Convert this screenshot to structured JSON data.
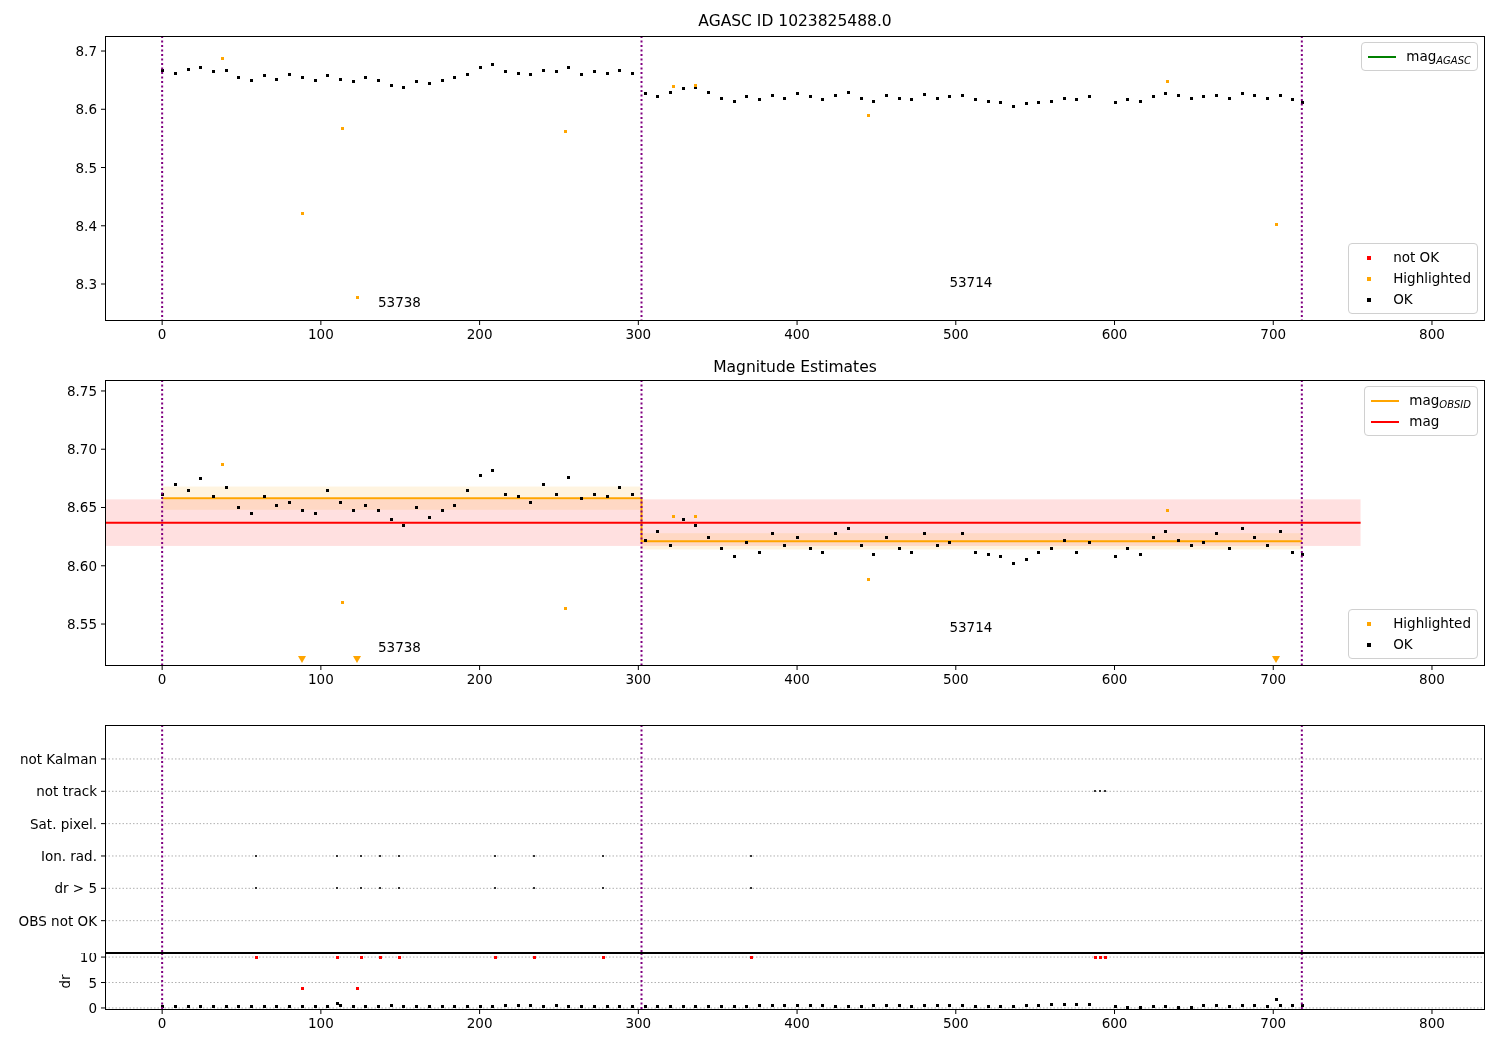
{
  "figure": {
    "panels": [
      {
        "chart_data": {
          "type": "scatter",
          "title": "AGASC ID 1023825488.0",
          "xlim": [
            -36,
            833.4
          ],
          "ylim": [
            8.2365,
            8.7258
          ],
          "xticks": [
            0,
            100,
            200,
            300,
            400,
            500,
            600,
            700,
            800
          ],
          "yticks": [
            8.3,
            8.4,
            8.5,
            8.6,
            8.7
          ],
          "legend": true,
          "series": [
            {
              "name": "OK",
              "color": "#000000",
              "type": "scatter",
              "x": [
                0,
                8,
                16,
                24,
                32,
                40,
                48,
                56,
                64,
                72,
                80,
                88,
                96,
                104,
                112,
                120,
                128,
                136,
                144,
                152,
                160,
                168,
                176,
                184,
                192,
                200,
                208,
                216,
                224,
                232,
                240,
                248,
                256,
                264,
                272,
                280,
                288,
                296,
                304,
                312,
                320,
                328,
                336,
                344,
                352,
                360,
                368,
                376,
                384,
                392,
                400,
                408,
                416,
                424,
                432,
                440,
                448,
                456,
                464,
                472,
                480,
                488,
                496,
                504,
                512,
                520,
                528,
                536,
                544,
                552,
                560,
                568,
                576,
                584,
                600,
                608,
                616,
                624,
                632,
                640,
                648,
                656,
                664,
                672,
                680,
                688,
                696,
                704,
                712,
                718
              ],
              "values": [
                8.668,
                8.662,
                8.67,
                8.672,
                8.665,
                8.668,
                8.655,
                8.65,
                8.658,
                8.652,
                8.66,
                8.655,
                8.65,
                8.658,
                8.652,
                8.648,
                8.655,
                8.65,
                8.642,
                8.638,
                8.648,
                8.645,
                8.65,
                8.655,
                8.66,
                8.672,
                8.678,
                8.665,
                8.662,
                8.66,
                8.668,
                8.665,
                8.672,
                8.66,
                8.665,
                8.662,
                8.668,
                8.662,
                8.628,
                8.622,
                8.63,
                8.636,
                8.638,
                8.63,
                8.62,
                8.615,
                8.622,
                8.618,
                8.625,
                8.62,
                8.628,
                8.622,
                8.618,
                8.625,
                8.63,
                8.62,
                8.615,
                8.625,
                8.62,
                8.618,
                8.626,
                8.62,
                8.622,
                8.625,
                8.618,
                8.615,
                8.612,
                8.605,
                8.61,
                8.612,
                8.615,
                8.62,
                8.618,
                8.622,
                8.612,
                8.618,
                8.615,
                8.622,
                8.628,
                8.625,
                8.62,
                8.622,
                8.625,
                8.62,
                8.628,
                8.625,
                8.62,
                8.625,
                8.618,
                8.612
              ]
            },
            {
              "name": "Highlighted",
              "color": "#ffa500",
              "type": "scatter",
              "x": [
                38,
                88,
                113,
                123,
                254,
                322,
                336,
                445,
                633,
                702
              ],
              "values": [
                8.688,
                8.422,
                8.568,
                8.278,
                8.563,
                8.64,
                8.642,
                8.59,
                8.648,
                8.403
              ]
            }
          ],
          "ref_lines": [
            {
              "axis": "x",
              "value": 0,
              "color": "#800080"
            },
            {
              "axis": "x",
              "value": 302,
              "color": "#800080"
            },
            {
              "axis": "x",
              "value": 718,
              "color": "#800080"
            }
          ],
          "annotations": [
            "53738",
            "53714"
          ]
        },
        "legend_extras": [
          {
            "label": "mag$_{AGASC}$",
            "kind": "line",
            "color": "#008000"
          },
          {
            "label": "not OK",
            "kind": "dot",
            "color": "#ff0000"
          }
        ]
      },
      {
        "chart_data": {
          "type": "scatter",
          "title": "Magnitude Estimates",
          "xlim": [
            -36,
            833.4
          ],
          "ylim": [
            8.514,
            8.7594
          ],
          "xticks": [
            0,
            100,
            200,
            300,
            400,
            500,
            600,
            700,
            800
          ],
          "yticks": [
            {
              "value": 8.55,
              "label": "8.55"
            },
            {
              "value": 8.6,
              "label": "8.60"
            },
            {
              "value": 8.65,
              "label": "8.65"
            },
            {
              "value": 8.7,
              "label": "8.70"
            },
            {
              "value": 8.75,
              "label": "8.75"
            }
          ],
          "legend": true,
          "series": [
            {
              "name": "mag$_{OBSID}$",
              "color": "#ffa500",
              "type": "line",
              "x": [
                0,
                302,
                302,
                718
              ],
              "values": [
                8.658,
                8.658,
                8.621,
                8.621
              ]
            },
            {
              "name": "mag",
              "color": "#ff0000",
              "type": "line",
              "x": [
                -36,
                755
              ],
              "values": [
                8.637,
                8.637
              ]
            },
            {
              "name": "OK",
              "color": "#000000",
              "type": "scatter",
              "x": [
                0,
                8,
                16,
                24,
                32,
                40,
                48,
                56,
                64,
                72,
                80,
                88,
                96,
                104,
                112,
                120,
                128,
                136,
                144,
                152,
                160,
                168,
                176,
                184,
                192,
                200,
                208,
                216,
                224,
                232,
                240,
                248,
                256,
                264,
                272,
                280,
                288,
                296,
                304,
                312,
                320,
                328,
                336,
                344,
                352,
                360,
                368,
                376,
                384,
                392,
                400,
                408,
                416,
                424,
                432,
                440,
                448,
                456,
                464,
                472,
                480,
                488,
                496,
                504,
                512,
                520,
                528,
                536,
                544,
                552,
                560,
                568,
                576,
                584,
                600,
                608,
                616,
                624,
                632,
                640,
                648,
                656,
                664,
                672,
                680,
                688,
                696,
                704,
                712,
                718
              ],
              "values": [
                8.662,
                8.67,
                8.665,
                8.675,
                8.66,
                8.668,
                8.65,
                8.645,
                8.66,
                8.652,
                8.655,
                8.648,
                8.645,
                8.665,
                8.655,
                8.648,
                8.652,
                8.648,
                8.64,
                8.635,
                8.65,
                8.642,
                8.648,
                8.652,
                8.665,
                8.678,
                8.682,
                8.662,
                8.66,
                8.655,
                8.67,
                8.662,
                8.676,
                8.658,
                8.662,
                8.66,
                8.668,
                8.662,
                8.622,
                8.63,
                8.618,
                8.64,
                8.635,
                8.625,
                8.615,
                8.608,
                8.62,
                8.612,
                8.628,
                8.618,
                8.625,
                8.615,
                8.612,
                8.628,
                8.632,
                8.618,
                8.61,
                8.625,
                8.615,
                8.612,
                8.628,
                8.618,
                8.62,
                8.628,
                8.612,
                8.61,
                8.608,
                8.602,
                8.606,
                8.612,
                8.615,
                8.622,
                8.612,
                8.62,
                8.608,
                8.615,
                8.61,
                8.625,
                8.63,
                8.622,
                8.618,
                8.62,
                8.628,
                8.615,
                8.632,
                8.625,
                8.618,
                8.63,
                8.612,
                8.61
              ]
            },
            {
              "name": "Highlighted",
              "color": "#ffa500",
              "type": "scatter",
              "x": [
                38,
                113,
                254,
                322,
                336,
                445,
                633
              ],
              "values": [
                8.687,
                8.569,
                8.564,
                8.643,
                8.643,
                8.589,
                8.648
              ]
            },
            {
              "color": "#ffa500",
              "type": "scatter",
              "marker": "triangle-down",
              "x": [
                88,
                123,
                702
              ],
              "values": [
                8.52,
                8.52,
                8.52
              ]
            }
          ],
          "bands": [
            {
              "axis": "y",
              "from": 8.617,
              "to": 8.657,
              "color": "#ff0000"
            },
            {
              "axis": "y",
              "from": 8.648,
              "to": 8.668,
              "color": "#ffa500"
            },
            {
              "axis": "y",
              "from": 8.614,
              "to": 8.628,
              "color": "#ffa500"
            }
          ],
          "ref_lines": [
            {
              "axis": "x",
              "value": 0,
              "color": "#800080"
            },
            {
              "axis": "x",
              "value": 302,
              "color": "#800080"
            },
            {
              "axis": "x",
              "value": 718,
              "color": "#800080"
            }
          ],
          "annotations": [
            "53738",
            "53714"
          ]
        }
      },
      {
        "chart_data": {
          "type": "scatter",
          "orientation": "horizontal",
          "xlim": [
            -36,
            833.4
          ],
          "grid": true,
          "categories": [
            "not Kalman",
            "not track",
            "Sat. pixel.",
            "Ion. rad.",
            "dr > 5",
            "OBS not OK"
          ],
          "series": [
            {
              "color": "#333333",
              "values": [
                null,
                null,
                null,
                59,
                59,
                null
              ]
            },
            {
              "color": "#333333",
              "values": [
                null,
                null,
                null,
                110,
                110,
                null
              ]
            },
            {
              "color": "#333333",
              "values": [
                null,
                null,
                null,
                125,
                125,
                null
              ]
            },
            {
              "color": "#333333",
              "values": [
                null,
                null,
                null,
                137,
                137,
                null
              ]
            },
            {
              "color": "#333333",
              "values": [
                null,
                null,
                null,
                149,
                149,
                null
              ]
            },
            {
              "color": "#333333",
              "values": [
                null,
                null,
                null,
                210,
                210,
                null
              ]
            },
            {
              "color": "#333333",
              "values": [
                null,
                null,
                null,
                234,
                234,
                null
              ]
            },
            {
              "color": "#333333",
              "values": [
                null,
                null,
                null,
                278,
                278,
                null
              ]
            },
            {
              "color": "#333333",
              "values": [
                null,
                null,
                null,
                371,
                371,
                null
              ]
            },
            {
              "color": "#333333",
              "values": [
                null,
                588,
                null,
                null,
                null,
                null
              ]
            },
            {
              "color": "#333333",
              "values": [
                null,
                591,
                null,
                null,
                null,
                null
              ]
            },
            {
              "color": "#333333",
              "values": [
                null,
                594,
                null,
                null,
                null,
                null
              ]
            }
          ],
          "ref_lines": [
            {
              "axis": "x",
              "value": 0,
              "color": "#800080"
            },
            {
              "axis": "x",
              "value": 302,
              "color": "#800080"
            },
            {
              "axis": "x",
              "value": 718,
              "color": "#800080"
            }
          ]
        }
      },
      {
        "chart_data": {
          "type": "scatter",
          "ylabel": "dr",
          "xlim": [
            -36,
            833.4
          ],
          "ylim": [
            -0.4,
            10.8
          ],
          "grid": true,
          "xticks": [
            0,
            100,
            200,
            300,
            400,
            500,
            600,
            700,
            800
          ],
          "yticks": [
            0,
            5,
            10
          ],
          "series": [
            {
              "color": "#000000",
              "type": "scatter",
              "x": [
                0,
                8,
                16,
                24,
                32,
                40,
                48,
                56,
                64,
                72,
                80,
                88,
                96,
                104,
                112,
                120,
                128,
                136,
                144,
                152,
                160,
                168,
                176,
                184,
                192,
                200,
                208,
                216,
                224,
                232,
                240,
                248,
                256,
                264,
                272,
                280,
                288,
                296,
                304,
                312,
                320,
                328,
                336,
                344,
                352,
                360,
                368,
                376,
                384,
                392,
                400,
                408,
                416,
                424,
                432,
                440,
                448,
                456,
                464,
                472,
                480,
                488,
                496,
                504,
                512,
                520,
                528,
                536,
                544,
                552,
                560,
                568,
                576,
                584,
                600,
                608,
                616,
                624,
                632,
                640,
                648,
                656,
                664,
                672,
                680,
                688,
                696,
                704,
                712,
                718,
                110,
                702
              ],
              "values": [
                0.3,
                0.3,
                0.3,
                0.3,
                0.3,
                0.3,
                0.4,
                0.3,
                0.3,
                0.3,
                0.3,
                0.3,
                0.3,
                0.3,
                0.5,
                0.4,
                0.3,
                0.3,
                0.5,
                0.4,
                0.3,
                0.3,
                0.3,
                0.3,
                0.3,
                0.3,
                0.4,
                0.5,
                0.5,
                0.5,
                0.4,
                0.5,
                0.4,
                0.3,
                0.3,
                0.3,
                0.3,
                0.3,
                0.3,
                0.3,
                0.3,
                0.4,
                0.4,
                0.3,
                0.3,
                0.3,
                0.4,
                0.5,
                0.5,
                0.5,
                0.5,
                0.5,
                0.5,
                0.4,
                0.3,
                0.4,
                0.5,
                0.5,
                0.5,
                0.4,
                0.5,
                0.5,
                0.5,
                0.5,
                0.4,
                0.3,
                0.3,
                0.4,
                0.5,
                0.6,
                0.7,
                0.8,
                0.8,
                0.8,
                0.3,
                0.2,
                0.2,
                0.3,
                0.3,
                0.2,
                0.2,
                0.6,
                0.5,
                0.4,
                0.5,
                0.5,
                0.4,
                0.6,
                0.5,
                0.6,
                1.0,
                1.8
              ]
            },
            {
              "color": "#ff0000",
              "type": "scatter",
              "x": [
                59,
                110,
                125,
                137,
                149,
                210,
                234,
                278,
                371,
                588,
                591,
                594,
                88,
                123
              ],
              "values": [
                10,
                10,
                10,
                10,
                10,
                10,
                10,
                10,
                10,
                10,
                10,
                10,
                4,
                4
              ]
            }
          ],
          "ref_lines": [
            {
              "axis": "x",
              "value": 0,
              "color": "#800080"
            },
            {
              "axis": "x",
              "value": 302,
              "color": "#800080"
            },
            {
              "axis": "x",
              "value": 718,
              "color": "#800080"
            }
          ]
        }
      }
    ]
  }
}
